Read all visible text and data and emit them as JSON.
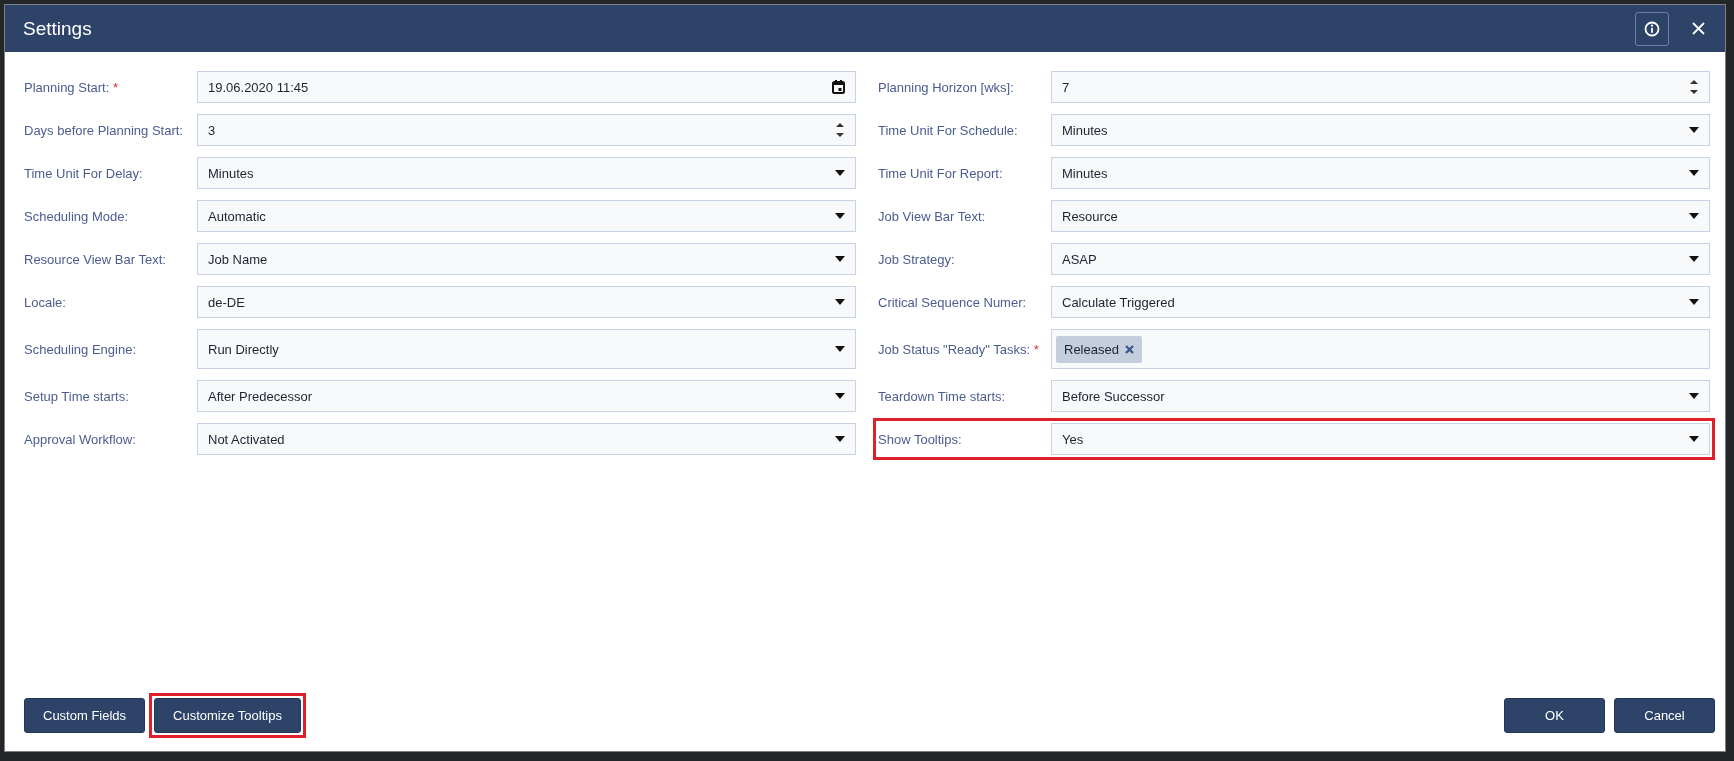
{
  "window": {
    "title": "Settings"
  },
  "header_buttons": [
    {
      "kind": "info"
    },
    {
      "kind": "close"
    }
  ],
  "rows": [
    [
      {
        "label": "Planning Start:",
        "required_mark": "*",
        "kind": "datetime",
        "value": "19.06.2020 11:45",
        "highlighted": false
      },
      {
        "label": "Planning Horizon [wks]:",
        "kind": "number",
        "value": "7",
        "highlighted": false
      }
    ],
    [
      {
        "label": "Days before Planning Start:",
        "kind": "number",
        "value": "3",
        "highlighted": false
      },
      {
        "label": "Time Unit For Schedule:",
        "kind": "select",
        "value": "Minutes",
        "highlighted": false
      }
    ],
    [
      {
        "label": "Time Unit For Delay:",
        "kind": "select",
        "value": "Minutes",
        "highlighted": false
      },
      {
        "label": "Time Unit For Report:",
        "kind": "select",
        "value": "Minutes",
        "highlighted": false
      }
    ],
    [
      {
        "label": "Scheduling Mode:",
        "kind": "select",
        "value": "Automatic",
        "highlighted": false
      },
      {
        "label": "Job View Bar Text:",
        "kind": "select",
        "value": "Resource",
        "highlighted": false
      }
    ],
    [
      {
        "label": "Resource View Bar Text:",
        "kind": "select",
        "value": "Job Name",
        "highlighted": false
      },
      {
        "label": "Job Strategy:",
        "kind": "select",
        "value": "ASAP",
        "highlighted": false
      }
    ],
    [
      {
        "label": "Locale:",
        "kind": "select",
        "value": "de-DE",
        "highlighted": false
      },
      {
        "label": "Critical Sequence Numer:",
        "kind": "select",
        "value": "Calculate Triggered",
        "highlighted": false
      }
    ],
    [
      {
        "label": "Scheduling Engine:",
        "kind": "select",
        "value": "Run Directly",
        "highlighted": false
      },
      {
        "label": "Job Status \"Ready\" Tasks:",
        "required_mark": "*",
        "kind": "tags",
        "tags": [
          "Released"
        ],
        "highlighted": false
      }
    ],
    [
      {
        "label": "Setup Time starts:",
        "kind": "select",
        "value": "After Predecessor",
        "highlighted": false
      },
      {
        "label": "Teardown Time starts:",
        "kind": "select",
        "value": "Before Successor",
        "highlighted": false
      }
    ],
    [
      {
        "label": "Approval Workflow:",
        "kind": "select",
        "value": "Not Activated",
        "highlighted": false
      },
      {
        "label": "Show Tooltips:",
        "kind": "select",
        "value": "Yes",
        "highlighted": true
      }
    ]
  ],
  "footer_left": [
    {
      "label": "Custom Fields",
      "highlighted": false
    },
    {
      "label": "Customize Tooltips",
      "highlighted": true
    }
  ],
  "footer_right": [
    {
      "label": "OK",
      "highlighted": false
    },
    {
      "label": "Cancel",
      "highlighted": false
    }
  ]
}
